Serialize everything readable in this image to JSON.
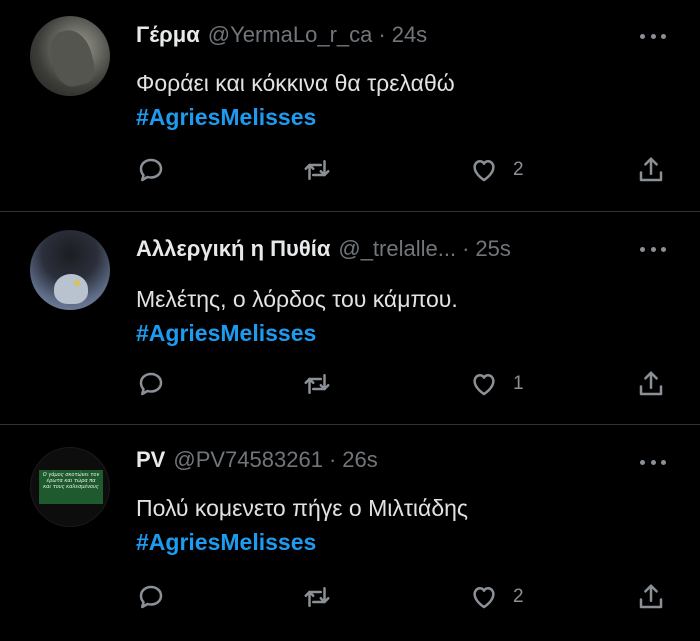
{
  "tweets": [
    {
      "name": "Γέρμα",
      "handle": "@YermaLo_r_ca",
      "separator": "·",
      "time": "24s",
      "text": "Φοράει και κόκκινα θα τρελαθώ",
      "hashtag": "#AgriesMelisses",
      "like_count": "2"
    },
    {
      "name": "Αλλεργική η Πυθία",
      "handle": "@_trelalle...",
      "separator": "·",
      "time": "25s",
      "text": "Μελέτης, ο λόρδος του κάμπου.",
      "hashtag": "#AgriesMelisses",
      "like_count": "1"
    },
    {
      "name": "PV",
      "handle": "@PV74583261",
      "separator": "·",
      "time": "26s",
      "text": "Πολύ κομενετο πήγε ο Μιλτιάδης",
      "hashtag": "#AgriesMelisses",
      "like_count": "2",
      "avatar_text": "Ο γάμος σκοτώνει τον έρωτα και τώρα πα και τους καλεσμένους"
    }
  ],
  "colors": {
    "background": "#000000",
    "hashtag": "#1d9bf0",
    "muted": "#71767b",
    "divider": "#2f3336"
  },
  "icons": {
    "reply": "reply-icon",
    "retweet": "retweet-icon",
    "like": "heart-icon",
    "share": "share-icon",
    "more": "more-icon"
  }
}
